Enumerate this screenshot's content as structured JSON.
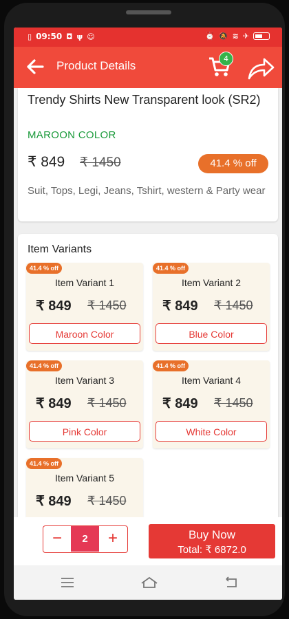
{
  "status": {
    "time": "09:50",
    "left_icons": [
      "sim-icon",
      "bluetooth-data-icon",
      "usb-icon",
      "android-icon"
    ],
    "right_icons": [
      "alarm-icon",
      "mute-icon",
      "wifi-icon",
      "airplane-icon",
      "battery-icon"
    ]
  },
  "appbar": {
    "title": "Product Details",
    "cart_count": "4"
  },
  "product": {
    "title": "Trendy Shirts New Transparent look (SR2)",
    "color": "MAROON COLOR",
    "price": "₹ 849",
    "mrp": "₹ 1450",
    "off": "41.4 % off",
    "description": "Suit, Tops, Legi, Jeans, Tshirt, western & Party wear"
  },
  "variants": {
    "heading": "Item Variants",
    "items": [
      {
        "badge": "41.4 % off",
        "name": "Item Variant 1",
        "price": "₹ 849",
        "mrp": "₹ 1450",
        "button": "Maroon Color"
      },
      {
        "badge": "41.4 % off",
        "name": "Item Variant 2",
        "price": "₹ 849",
        "mrp": "₹ 1450",
        "button": "Blue Color"
      },
      {
        "badge": "41.4 % off",
        "name": "Item Variant 3",
        "price": "₹ 849",
        "mrp": "₹ 1450",
        "button": "Pink Color"
      },
      {
        "badge": "41.4 % off",
        "name": "Item Variant 4",
        "price": "₹ 849",
        "mrp": "₹ 1450",
        "button": "White Color"
      },
      {
        "badge": "41.4 % off",
        "name": "Item Variant 5",
        "price": "₹ 849",
        "mrp": "₹ 1450",
        "button": ""
      }
    ]
  },
  "cart_bar": {
    "minus": "−",
    "quantity": "2",
    "plus": "+",
    "buy_label": "Buy Now",
    "total": "Total: ₹ 6872.0"
  },
  "colors": {
    "appbar": "#f04a3b",
    "status": "#e5322f",
    "accent": "#e53935",
    "discount": "#e8702a",
    "green": "#1a9a3a"
  }
}
